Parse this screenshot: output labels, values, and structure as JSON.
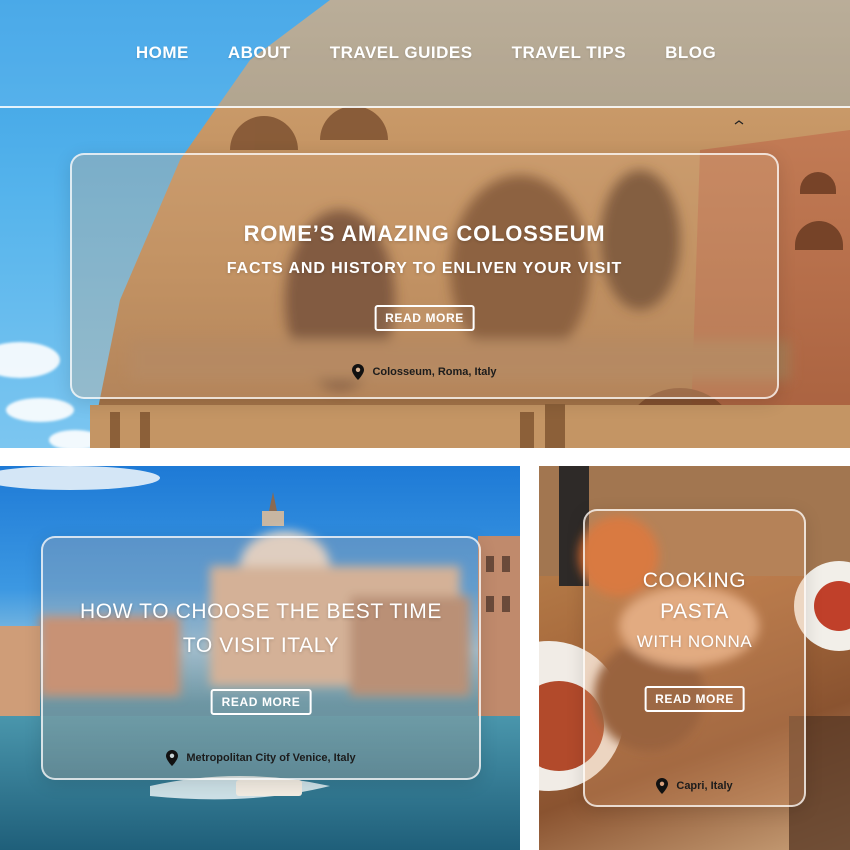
{
  "nav": {
    "items": [
      "HOME",
      "ABOUT",
      "TRAVEL GUIDES",
      "TRAVEL TIPS",
      "BLOG"
    ]
  },
  "hero_card": {
    "title": "ROME’S AMAZING COLOSSEUM",
    "subtitle": "FACTS AND HISTORY TO ENLIVEN YOUR VISIT",
    "button": "READ MORE",
    "location": "Colosseum, Roma, Italy"
  },
  "venice_card": {
    "title_line1": "HOW TO CHOOSE THE BEST TIME",
    "title_line2": "TO VISIT ITALY",
    "button": "READ MORE",
    "location": "Metropolitan City of Venice, Italy"
  },
  "food_card": {
    "title_line1": "COOKING",
    "title_line2": "PASTA",
    "title_line3": "WITH NONNA",
    "button": "READ MORE",
    "location": "Capri, Italy"
  },
  "icons": {
    "location": "map-pin-icon"
  },
  "colors": {
    "sky": "#3aa0e4",
    "stone": "#c99a6a",
    "card_border": "#ffffff",
    "location_text": "#1c1c1c"
  }
}
